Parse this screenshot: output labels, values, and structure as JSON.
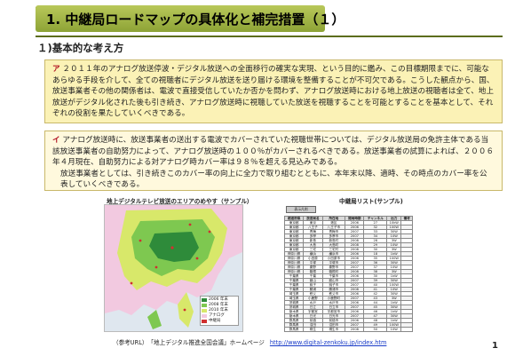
{
  "header": {
    "title": "1. 中継局ロードマップの具体化と補完措置（１）",
    "accent": "#8da336"
  },
  "section": {
    "heading": "１)基本的な考え方"
  },
  "box_a": {
    "marker": "ア",
    "text": "２０１１年のアナログ放送停波・デジタル放送への全面移行の確実な実現、という目的に鑑み、この目標期限までに、可能なあらゆる手段を介して、全ての視聴者にデジタル放送を送り届ける環境を整備することが不可欠である。こうした観点から、国、放送事業者その他の関係者は、電波で直接受信していたか否かを問わず、アナログ放送時における地上放送の視聴者は全て、地上放送がデジタル化された後も引き続き、アナログ放送時に視聴していた放送を視聴することを可能とすることを基本として、それぞれの役割を果たしていくべきである。"
  },
  "box_i": {
    "marker": "イ",
    "text1": "アナログ放送時に、放送事業者の送出する電波でカバーされていた視聴世帯については、デジタル放送局の免許主体である当該放送事業者の自助努力によって、アナログ放送時の１００％がカバーされるべきである。放送事業者の試算によれば、２００６年４月現在、自助努力による対アナログ時カバー率は９８％を超える見込みである。",
    "text2": "放送事業者としては、引き続きこのカバー率の向上に全力で取り組むとともに、本年末以降、適時、その時点のカバー率を公表していくべきである。"
  },
  "map_panel": {
    "caption": "地上デジタルテレビ放送のエリアのめやす（サンプル）",
    "legend": [
      {
        "label": "2006 年末",
        "color": "#2e8b3a"
      },
      {
        "label": "2008 年末",
        "color": "#7ec850"
      },
      {
        "label": "2010 年末",
        "color": "#d8e86a"
      },
      {
        "label": "アナログ",
        "color": "#f2c9e0"
      },
      {
        "label": "中継局",
        "color": "#d03030"
      }
    ]
  },
  "list_panel": {
    "caption": "中継局リスト(サンプル)",
    "note": "表示凡例",
    "columns": [
      "都道府県",
      "放送局名",
      "所在地",
      "開局時期",
      "チャンネル",
      "出力",
      "備考"
    ],
    "rows": [
      [
        "東京都",
        "東京",
        "港区",
        "2006",
        "27",
        "10kW",
        ""
      ],
      [
        "東京都",
        "八王子",
        "八王子市",
        "2006",
        "32",
        "100W",
        ""
      ],
      [
        "東京都",
        "青梅",
        "青梅市",
        "2007",
        "33",
        "30W",
        ""
      ],
      [
        "東京都",
        "多摩",
        "多摩市",
        "2007",
        "34",
        "10W",
        ""
      ],
      [
        "東京都",
        "新島",
        "新島村",
        "2008",
        "28",
        "3W",
        ""
      ],
      [
        "東京都",
        "大島",
        "大島町",
        "2008",
        "29",
        "10W",
        ""
      ],
      [
        "東京都",
        "三宅",
        "三宅村",
        "2008",
        "30",
        "3W",
        ""
      ],
      [
        "神奈川県",
        "横浜",
        "横浜市",
        "2006",
        "18",
        "1kW",
        ""
      ],
      [
        "神奈川県",
        "小田原",
        "小田原市",
        "2006",
        "35",
        "100W",
        ""
      ],
      [
        "神奈川県",
        "平塚",
        "平塚市",
        "2007",
        "36",
        "30W",
        ""
      ],
      [
        "神奈川県",
        "秦野",
        "秦野市",
        "2007",
        "37",
        "10W",
        ""
      ],
      [
        "神奈川県",
        "箱根",
        "箱根町",
        "2008",
        "38",
        "3W",
        ""
      ],
      [
        "千葉県",
        "千葉",
        "千葉市",
        "2006",
        "30",
        "1kW",
        ""
      ],
      [
        "千葉県",
        "館山",
        "館山市",
        "2007",
        "39",
        "30W",
        ""
      ],
      [
        "千葉県",
        "銚子",
        "銚子市",
        "2007",
        "40",
        "100W",
        ""
      ],
      [
        "千葉県",
        "勝浦",
        "勝浦市",
        "2008",
        "41",
        "10W",
        ""
      ],
      [
        "埼玉県",
        "秩父",
        "秩父市",
        "2006",
        "42",
        "30W",
        ""
      ],
      [
        "埼玉県",
        "小鹿野",
        "小鹿野町",
        "2007",
        "43",
        "3W",
        ""
      ],
      [
        "茨城県",
        "水戸",
        "水戸市",
        "2006",
        "44",
        "1kW",
        ""
      ],
      [
        "茨城県",
        "日立",
        "日立市",
        "2007",
        "45",
        "30W",
        ""
      ],
      [
        "栃木県",
        "宇都宮",
        "宇都宮市",
        "2006",
        "46",
        "1kW",
        ""
      ],
      [
        "栃木県",
        "日光",
        "日光市",
        "2007",
        "47",
        "30W",
        ""
      ],
      [
        "群馬県",
        "前橋",
        "前橋市",
        "2006",
        "48",
        "1kW",
        ""
      ],
      [
        "群馬県",
        "沼田",
        "沼田市",
        "2007",
        "49",
        "100W",
        ""
      ],
      [
        "群馬県",
        "桐生",
        "桐生市",
        "2008",
        "50",
        "10W",
        ""
      ],
      [
        "山梨県",
        "甲府",
        "甲府市",
        "2006",
        "51",
        "1kW",
        ""
      ],
      [
        "山梨県",
        "富士吉田",
        "富士吉田市",
        "2008",
        "52",
        "30W",
        ""
      ]
    ]
  },
  "footer": {
    "label": "（参考URL）　「地上デジタル推進全国会議」ホームページ",
    "url": "http://www.digital-zenkoku.jp/index.htm"
  },
  "page_number": "1"
}
